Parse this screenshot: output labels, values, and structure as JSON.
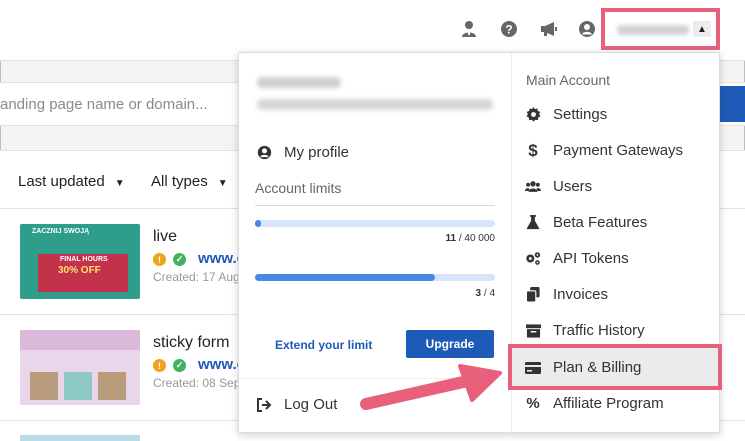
{
  "topbar": {
    "icons": [
      "person-pin-icon",
      "help-icon",
      "megaphone-icon",
      "account-circle-icon"
    ]
  },
  "background": {
    "search_placeholder": "anding page name or domain...",
    "filters": {
      "sort_label": "Last updated",
      "type_label": "All types"
    },
    "rows": [
      {
        "title": "live",
        "url": "www.c",
        "created": "Created: 17 Aug",
        "thumb_heading": "ZACZNIJ SWOJĄ",
        "thumb_promo_top": "FINAL HOURS",
        "thumb_promo": "30% OFF"
      },
      {
        "title": "sticky form",
        "url": "www.c",
        "created": "Created: 08 Sep"
      }
    ]
  },
  "dropdown": {
    "my_profile": "My profile",
    "account_limits_label": "Account limits",
    "limits": [
      {
        "used": "11",
        "total": "40 000",
        "separator": " / ",
        "fraction": 0.012
      },
      {
        "used": "3",
        "total": "4",
        "separator": " / ",
        "fraction": 0.75
      }
    ],
    "extend_limit": "Extend your limit",
    "upgrade": "Upgrade",
    "log_out": "Log Out",
    "main_account_label": "Main Account",
    "menu": [
      {
        "label": "Settings",
        "icon": "gear-icon"
      },
      {
        "label": "Payment Gateways",
        "icon": "dollar-icon"
      },
      {
        "label": "Users",
        "icon": "users-icon"
      },
      {
        "label": "Beta Features",
        "icon": "flask-icon"
      },
      {
        "label": "API Tokens",
        "icon": "gears-icon"
      },
      {
        "label": "Invoices",
        "icon": "copy-icon"
      },
      {
        "label": "Traffic History",
        "icon": "archive-icon"
      },
      {
        "label": "Plan & Billing",
        "icon": "credit-card-icon"
      },
      {
        "label": "Affiliate Program",
        "icon": "percent-icon"
      }
    ]
  },
  "colors": {
    "highlight": "#e8607c",
    "accent": "#1e5bb8",
    "bar_fill": "#4a86e8",
    "bar_track": "#d8e4fb"
  }
}
